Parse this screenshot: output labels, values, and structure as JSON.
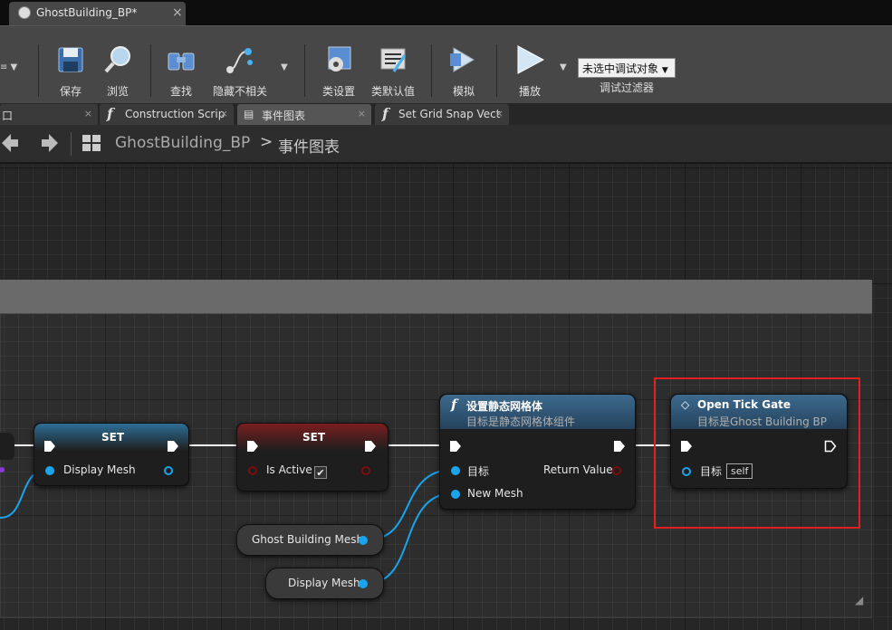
{
  "document_tab": {
    "title": "GhostBuilding_BP*",
    "close": "×"
  },
  "toolbar": {
    "items": [
      {
        "label": "保存",
        "icon": "save-icon"
      },
      {
        "label": "浏览",
        "icon": "browse-icon"
      },
      {
        "label": "查找",
        "icon": "find-icon"
      },
      {
        "label": "隐藏不相关",
        "icon": "hide-unrelated-icon"
      },
      {
        "label": "类设置",
        "icon": "class-settings-icon"
      },
      {
        "label": "类默认值",
        "icon": "class-defaults-icon"
      },
      {
        "label": "模拟",
        "icon": "simulate-icon"
      },
      {
        "label": "播放",
        "icon": "play-icon"
      }
    ],
    "debug_object": "未选中调试对象",
    "debug_filter": "调试过滤器"
  },
  "graph_tabs": [
    {
      "label": "口",
      "active": false
    },
    {
      "label": "Construction Scrip",
      "active": false
    },
    {
      "label": "事件图表",
      "active": true
    },
    {
      "label": "Set Grid Snap Vect",
      "active": false
    }
  ],
  "breadcrumb": {
    "blueprint": "GhostBuilding_BP",
    "separator": ">",
    "graph": "事件图表"
  },
  "nodes": {
    "set_display_mesh": {
      "title": "SET",
      "pin": "Display Mesh"
    },
    "set_is_active": {
      "title": "SET",
      "pin": "Is Active",
      "checked": "✔"
    },
    "set_static_mesh": {
      "title": "设置静态网格体",
      "subtitle": "目标是静态网格体组件",
      "pin_target": "目标",
      "pin_new_mesh": "New Mesh",
      "pin_return": "Return Value"
    },
    "open_tick_gate": {
      "title": "Open Tick Gate",
      "subtitle": "目标是Ghost Building BP",
      "pin_target": "目标",
      "self": "self"
    },
    "ghost_building_mesh": {
      "label": "Ghost Building Mesh"
    },
    "display_mesh_var": {
      "label": "Display Mesh"
    }
  },
  "colors": {
    "exec": "#ffffff",
    "object_pin": "#19a4ef",
    "bool_pin": "#b01010",
    "highlight": "#e22020"
  }
}
